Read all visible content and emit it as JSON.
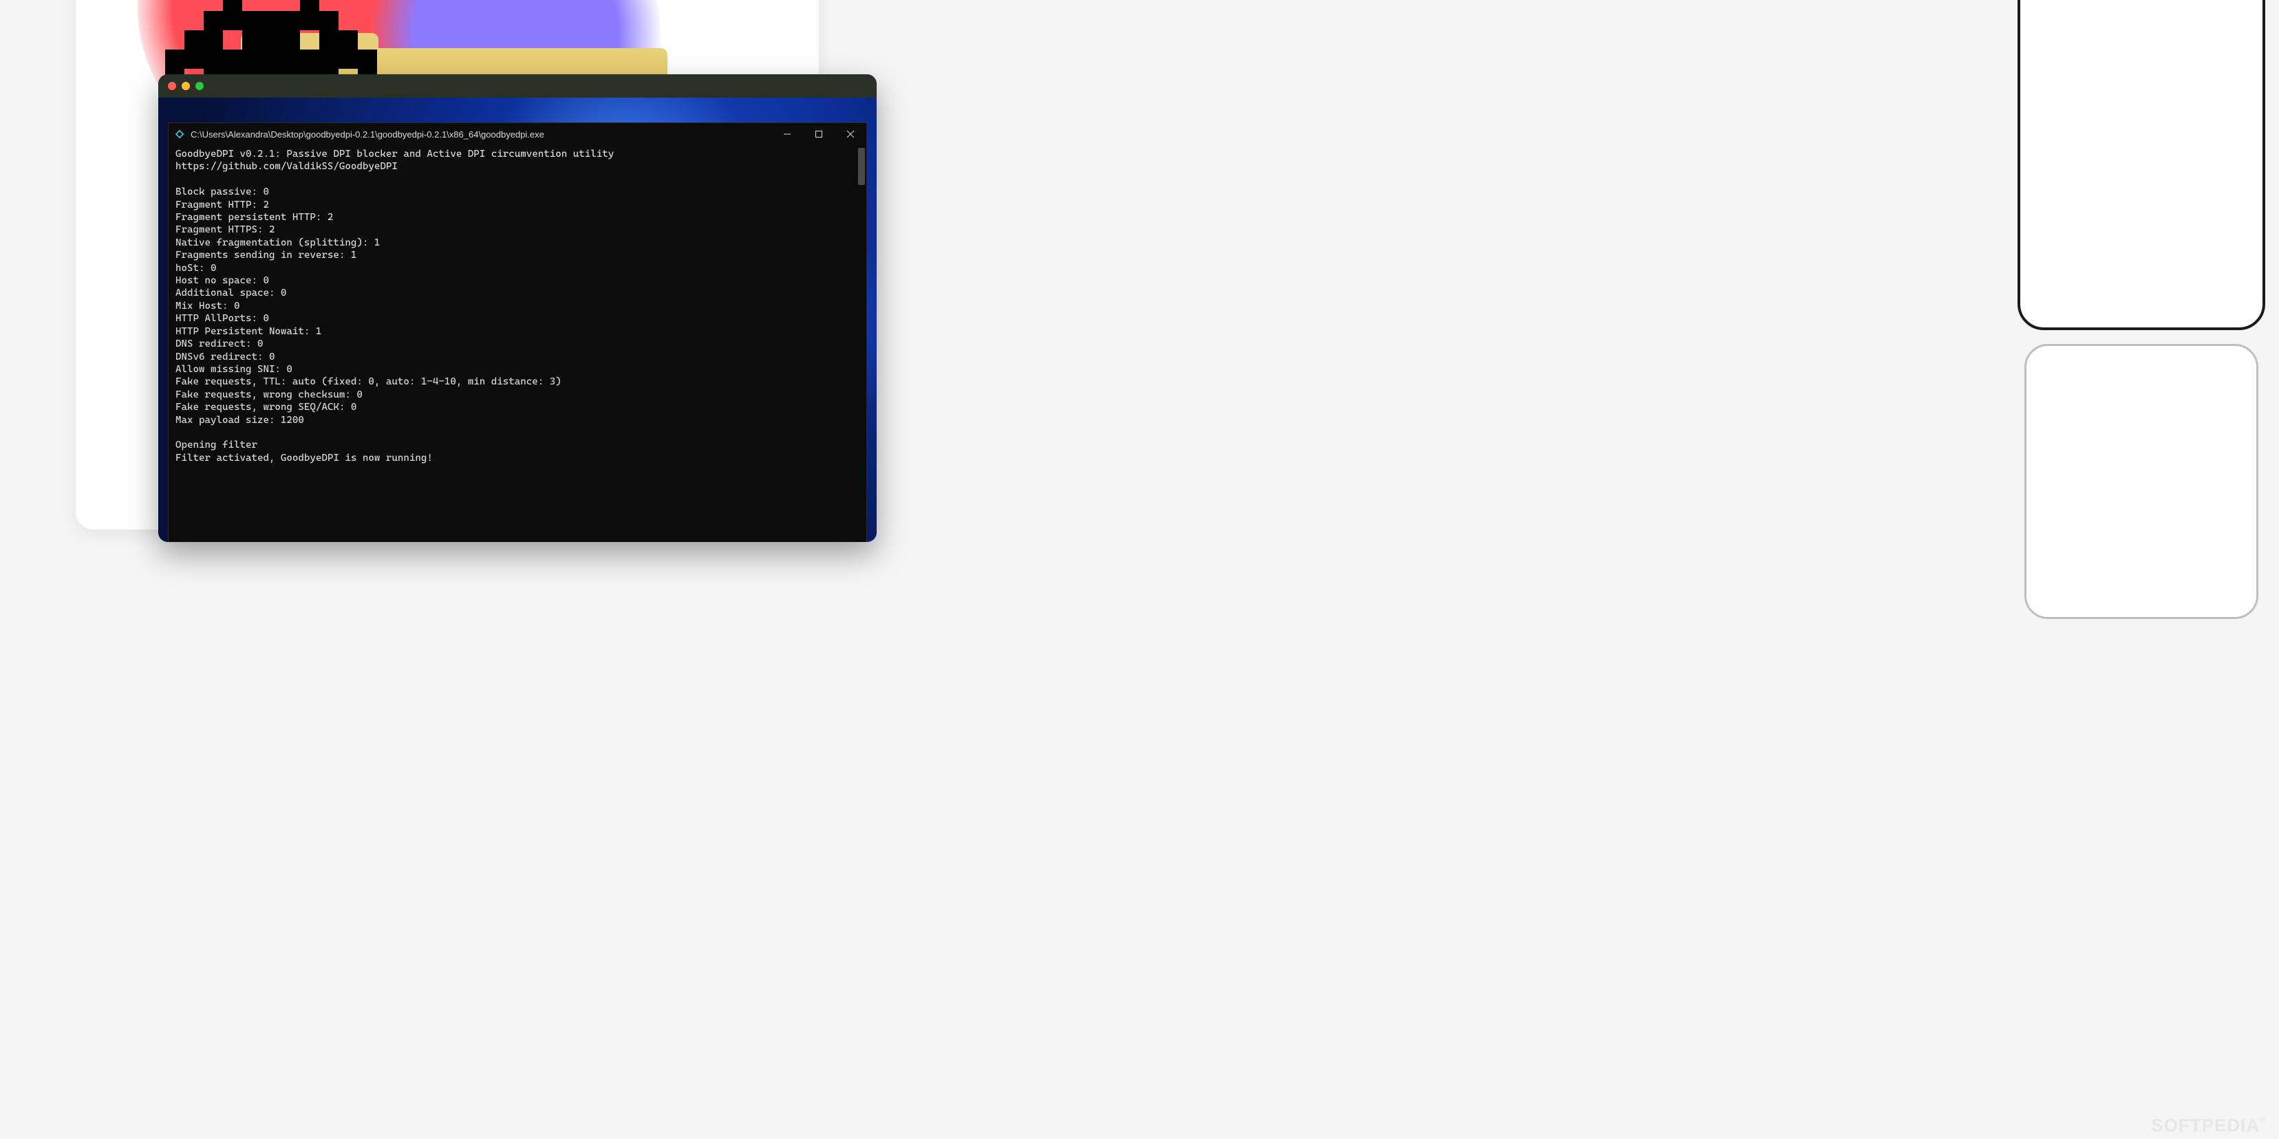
{
  "watermark": "SOFTPEDIA",
  "windows_console": {
    "title": "C:\\Users\\Alexandra\\Desktop\\goodbyedpi-0.2.1\\goodbyedpi-0.2.1\\x86_64\\goodbyedpi.exe",
    "lines": [
      "GoodbyeDPI v0.2.1: Passive DPI blocker and Active DPI circumvention utility",
      "https://github.com/ValdikSS/GoodbyeDPI",
      "",
      "Block passive: 0",
      "Fragment HTTP: 2",
      "Fragment persistent HTTP: 2",
      "Fragment HTTPS: 2",
      "Native fragmentation (splitting): 1",
      "Fragments sending in reverse: 1",
      "hoSt: 0",
      "Host no space: 0",
      "Additional space: 0",
      "Mix Host: 0",
      "HTTP AllPorts: 0",
      "HTTP Persistent Nowait: 1",
      "DNS redirect: 0",
      "DNSv6 redirect: 0",
      "Allow missing SNI: 0",
      "Fake requests, TTL: auto (fixed: 0, auto: 1-4-10, min distance: 3)",
      "Fake requests, wrong checksum: 0",
      "Fake requests, wrong SEQ/ACK: 0",
      "Max payload size: 1200",
      "",
      "Opening filter",
      "Filter activated, GoodbyeDPI is now running!"
    ]
  },
  "invader_pattern": [
    "00100000100",
    "00010001000",
    "00111111100",
    "01101110110",
    "11111111111",
    "10111111101",
    "10100000101",
    "00011011000"
  ]
}
